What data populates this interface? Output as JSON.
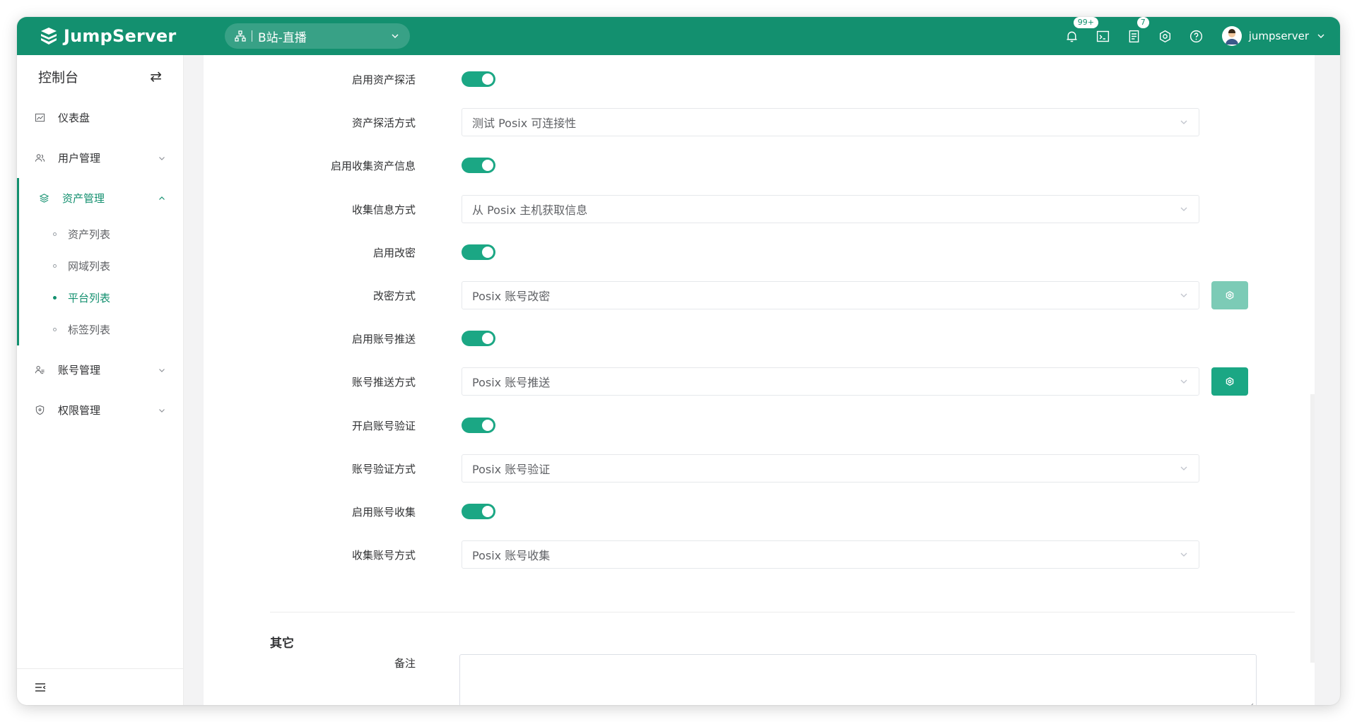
{
  "app": {
    "brand": "JumpServer",
    "org_selector": "B站-直播",
    "notifications_badge": "99+",
    "tasks_badge": "7",
    "user_name": "jumpserver"
  },
  "sidebar": {
    "title": "控制台",
    "items": {
      "dashboard": "仪表盘",
      "user_mgmt": "用户管理",
      "asset_mgmt": "资产管理",
      "account_mgmt": "账号管理",
      "perm_mgmt": "权限管理"
    },
    "asset_sub": {
      "asset_list": "资产列表",
      "domain_list": "网域列表",
      "platform_list": "平台列表",
      "label_list": "标签列表"
    }
  },
  "form": {
    "rows": [
      {
        "label": "启用资产探活",
        "type": "switch",
        "on": true
      },
      {
        "label": "资产探活方式",
        "type": "select",
        "value": "测试 Posix 可连接性"
      },
      {
        "label": "启用收集资产信息",
        "type": "switch",
        "on": true
      },
      {
        "label": "收集信息方式",
        "type": "select",
        "value": "从 Posix 主机获取信息"
      },
      {
        "label": "启用改密",
        "type": "switch",
        "on": true
      },
      {
        "label": "改密方式",
        "type": "select",
        "value": "Posix 账号改密"
      },
      {
        "label": "启用账号推送",
        "type": "switch",
        "on": true
      },
      {
        "label": "账号推送方式",
        "type": "select",
        "value": "Posix 账号推送"
      },
      {
        "label": "开启账号验证",
        "type": "switch",
        "on": true
      },
      {
        "label": "账号验证方式",
        "type": "select",
        "value": "Posix 账号验证"
      },
      {
        "label": "启用账号收集",
        "type": "switch",
        "on": true
      },
      {
        "label": "收集账号方式",
        "type": "select",
        "value": "Posix 账号收集"
      }
    ],
    "other_section_title": "其它",
    "comment_label": "备注"
  },
  "colors": {
    "brand_green": "#13906f",
    "switch_on": "#1ba784",
    "gear_button_disabled": "#7ccbb6"
  }
}
